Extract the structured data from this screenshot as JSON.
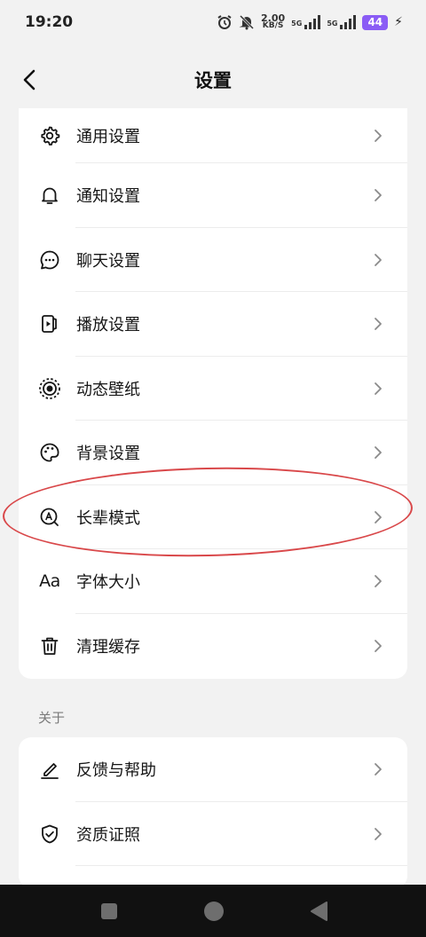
{
  "status_bar": {
    "time": "19:20",
    "speed_value": "2.00",
    "speed_unit": "KB/S",
    "net1": "5G",
    "net2": "5G",
    "battery": "44"
  },
  "header": {
    "title": "设置"
  },
  "settings": {
    "items": [
      {
        "label": "通用设置",
        "icon": "gear-icon"
      },
      {
        "label": "通知设置",
        "icon": "bell-icon"
      },
      {
        "label": "聊天设置",
        "icon": "chat-bubble-icon"
      },
      {
        "label": "播放设置",
        "icon": "play-icon"
      },
      {
        "label": "动态壁纸",
        "icon": "live-wallpaper-icon"
      },
      {
        "label": "背景设置",
        "icon": "palette-icon"
      },
      {
        "label": "长辈模式",
        "icon": "elder-mode-icon"
      },
      {
        "label": "字体大小",
        "icon": "font-size-icon",
        "icon_text": "Aa"
      },
      {
        "label": "清理缓存",
        "icon": "trash-icon"
      }
    ]
  },
  "about": {
    "section_label": "关于",
    "items": [
      {
        "label": "反馈与帮助",
        "icon": "pencil-icon"
      },
      {
        "label": "资质证照",
        "icon": "shield-check-icon"
      }
    ]
  },
  "highlight_color": "#d9484a"
}
